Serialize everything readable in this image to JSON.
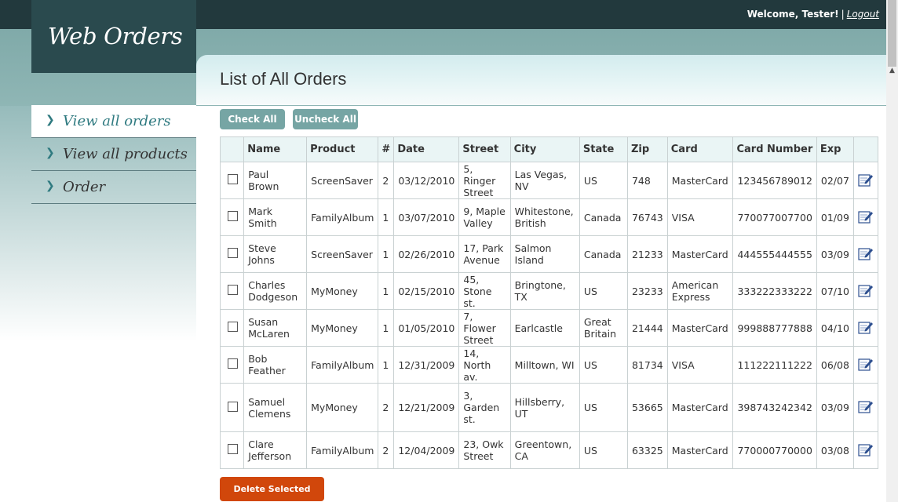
{
  "header": {
    "logo": "Web Orders",
    "welcome": "Welcome, Tester!",
    "separator": "|",
    "logout": "Logout"
  },
  "nav": {
    "items": [
      {
        "label": "View all orders"
      },
      {
        "label": "View all products"
      },
      {
        "label": "Order"
      }
    ]
  },
  "page": {
    "title": "List of All Orders",
    "check_all": "Check All",
    "uncheck_all": "Uncheck All",
    "delete_selected": "Delete Selected"
  },
  "table": {
    "headers": [
      "Name",
      "Product",
      "#",
      "Date",
      "Street",
      "City",
      "State",
      "Zip",
      "Card",
      "Card Number",
      "Exp"
    ],
    "rows": [
      [
        "Paul Brown",
        "ScreenSaver",
        "2",
        "03/12/2010",
        "5, Ringer Street",
        "Las Vegas, NV",
        "US",
        "748",
        "MasterCard",
        "123456789012",
        "02/07"
      ],
      [
        "Mark Smith",
        "FamilyAlbum",
        "1",
        "03/07/2010",
        "9, Maple Valley",
        "Whitestone, British",
        "Canada",
        "76743",
        "VISA",
        "770077007700",
        "01/09"
      ],
      [
        "Steve Johns",
        "ScreenSaver",
        "1",
        "02/26/2010",
        "17, Park Avenue",
        "Salmon Island",
        "Canada",
        "21233",
        "MasterCard",
        "444555444555",
        "03/09"
      ],
      [
        "Charles Dodgeson",
        "MyMoney",
        "1",
        "02/15/2010",
        "45, Stone st.",
        "Bringtone, TX",
        "US",
        "23233",
        "American Express",
        "333222333222",
        "07/10"
      ],
      [
        "Susan McLaren",
        "MyMoney",
        "1",
        "01/05/2010",
        "7, Flower Street",
        "Earlcastle",
        "Great Britain",
        "21444",
        "MasterCard",
        "999888777888",
        "04/10"
      ],
      [
        "Bob Feather",
        "FamilyAlbum",
        "1",
        "12/31/2009",
        "14, North av.",
        "Milltown, WI",
        "US",
        "81734",
        "VISA",
        "111222111222",
        "06/08"
      ],
      [
        "Samuel Clemens",
        "MyMoney",
        "2",
        "12/21/2009",
        "3, Garden st.",
        "Hillsberry, UT",
        "US",
        "53665",
        "MasterCard",
        "398743242342",
        "03/09"
      ],
      [
        "Clare Jefferson",
        "FamilyAlbum",
        "2",
        "12/04/2009",
        "23, Owk Street",
        "Greentown, CA",
        "US",
        "63325",
        "MasterCard",
        "770000770000",
        "03/08"
      ]
    ]
  },
  "icons": {
    "row_edit": "edit-icon",
    "nav_chevron": "chevron-right-icon",
    "row_checkbox": "checkbox-icon"
  },
  "colors": {
    "topbar": "#22393d",
    "logo_bg": "#2a4a4e",
    "accent": "#2f7a80",
    "button": "#76a5a4",
    "delete": "#d1470b"
  }
}
